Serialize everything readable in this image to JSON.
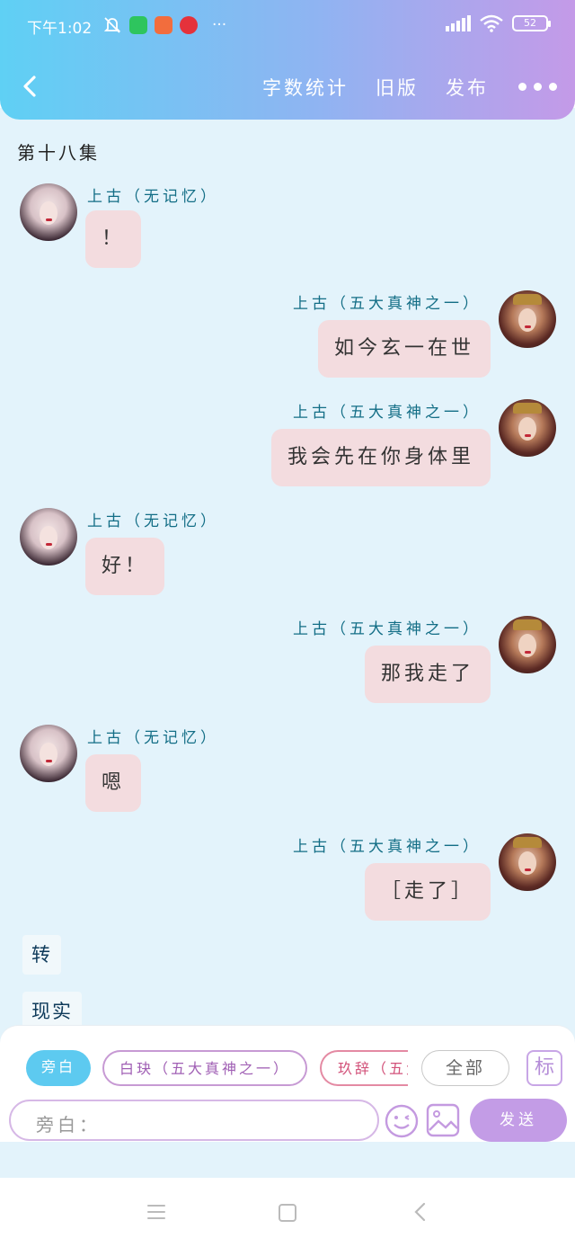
{
  "status_bar": {
    "time": "下午1:02",
    "more": "···",
    "battery": "52"
  },
  "nav": {
    "word_count": "字数统计",
    "old_version": "旧版",
    "publish": "发布"
  },
  "episode_title": "第十八集",
  "messages": [
    {
      "side": "left",
      "speaker": "上古（无记忆）",
      "text": "！"
    },
    {
      "side": "right",
      "speaker": "上古（五大真神之一）",
      "text": "如今玄一在世"
    },
    {
      "side": "right",
      "speaker": "上古（五大真神之一）",
      "text": "我会先在你身体里"
    },
    {
      "side": "left",
      "speaker": "上古（无记忆）",
      "text": "好！"
    },
    {
      "side": "right",
      "speaker": "上古（五大真神之一）",
      "text": "那我走了"
    },
    {
      "side": "left",
      "speaker": "上古（无记忆）",
      "text": "嗯"
    },
    {
      "side": "right",
      "speaker": "上古（五大真神之一）",
      "text": "［走了］"
    }
  ],
  "narrations": [
    "转",
    "现实"
  ],
  "composer": {
    "chips": {
      "narration": "旁白",
      "role_b": "白玦（五大真神之一）",
      "role_c": "玖辞（五大",
      "all": "全部",
      "mark": "标"
    },
    "input_placeholder": "旁白：",
    "send": "发送"
  }
}
